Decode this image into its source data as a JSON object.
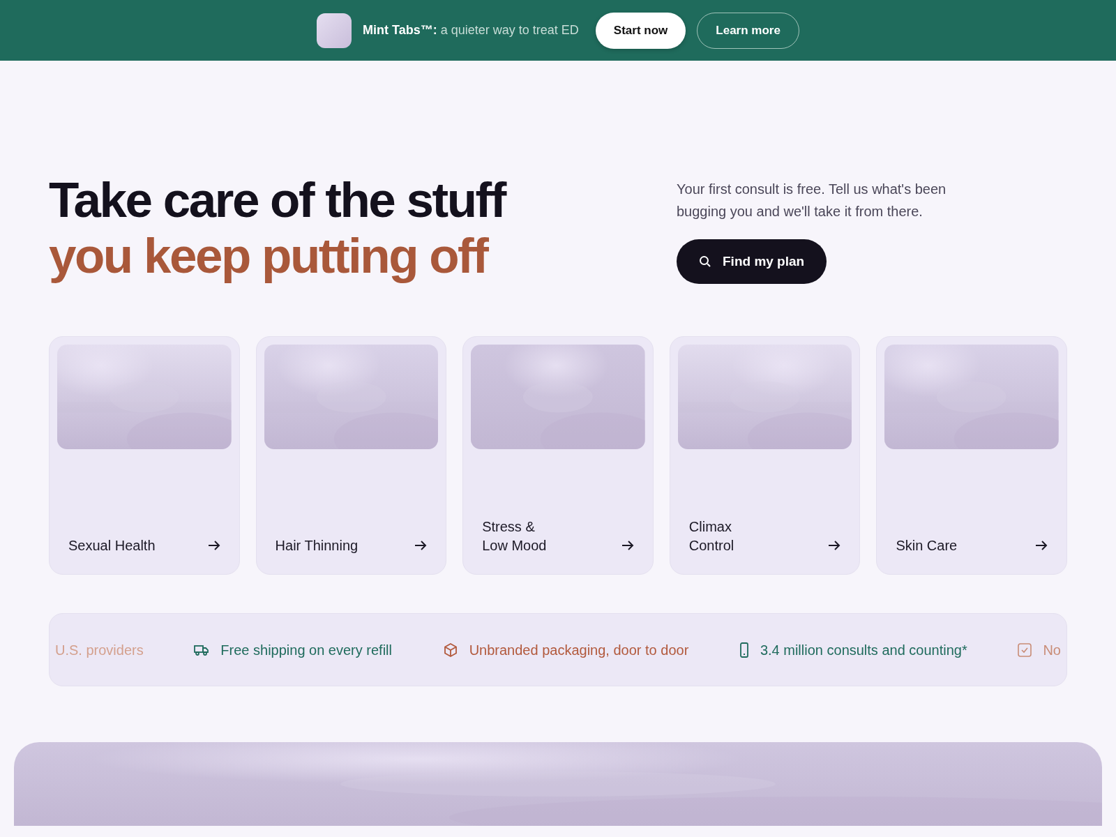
{
  "promo_bar": {
    "product": "Mint Tabs™:",
    "tagline": "a quieter way to treat ED",
    "buttons": [
      "Start now",
      "Learn more"
    ]
  },
  "hero": {
    "headline_line_1": "Take care of the stuff",
    "headline_line_2": "you keep putting off",
    "intro": "Your first consult is free. Tell us what's been bugging you and we'll take it from there.",
    "cta": "Find my plan"
  },
  "categories": [
    {
      "label": "Sexual Health"
    },
    {
      "label": "Hair Thinning"
    },
    {
      "label": "Stress &\nLow Mood"
    },
    {
      "label": "Climax\nControl"
    },
    {
      "label": "Skin Care"
    }
  ],
  "benefits": [
    {
      "kind": "none",
      "text": "U.S. providers",
      "color": "#d4a08d"
    },
    {
      "kind": "truck",
      "text": "Free shipping on every refill",
      "color": "#1f6b5c"
    },
    {
      "kind": "box",
      "text": "Unbranded packaging, door to door",
      "color": "#b2593c"
    },
    {
      "kind": "phone",
      "text": "3.4 million consults and counting*",
      "color": "#1f6b5c"
    },
    {
      "kind": "check",
      "text": "No",
      "color": "#c98c76"
    }
  ]
}
